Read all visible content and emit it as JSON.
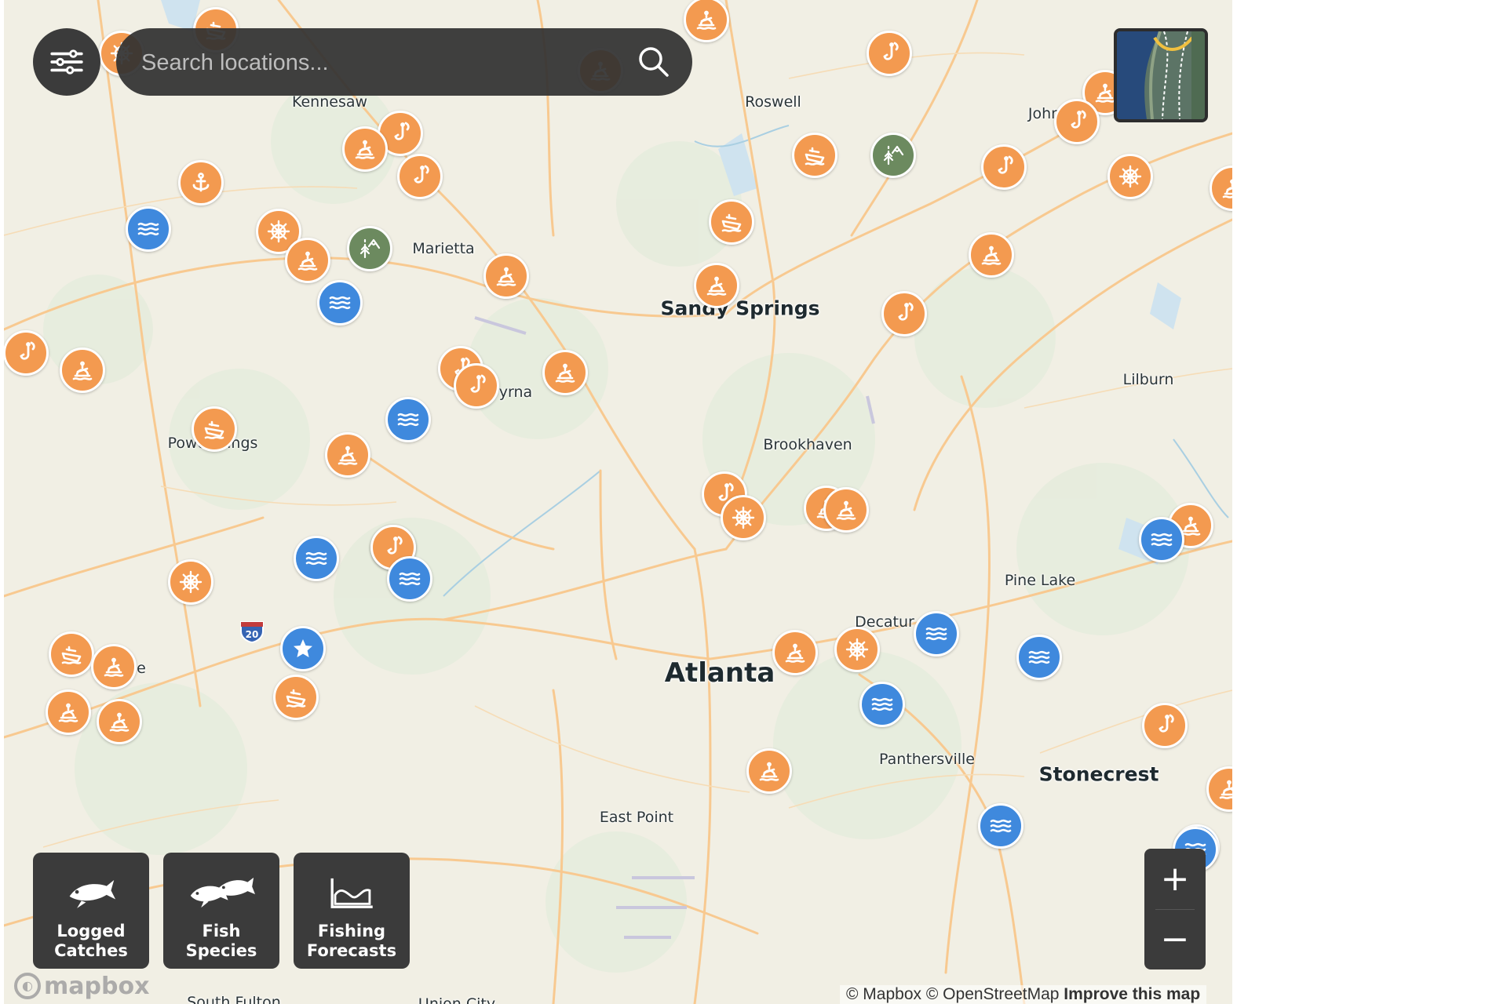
{
  "search": {
    "placeholder": "Search locations..."
  },
  "cities": [
    {
      "name": "Kennesaw",
      "size": "small"
    },
    {
      "name": "Roswell",
      "size": "small"
    },
    {
      "name": "John…",
      "size": "small"
    },
    {
      "name": "Marietta",
      "size": "small"
    },
    {
      "name": "Sandy Springs",
      "size": "med"
    },
    {
      "name": "Lilburn",
      "size": "small"
    },
    {
      "name": "yrna",
      "size": "small"
    },
    {
      "name": "Powde  rings",
      "size": "small"
    },
    {
      "name": "Brookhaven",
      "size": "small"
    },
    {
      "name": "Pine Lake",
      "size": "small"
    },
    {
      "name": "Decatur",
      "size": "small"
    },
    {
      "name": "Atlanta",
      "size": "big"
    },
    {
      "name": "Panthersville",
      "size": "small"
    },
    {
      "name": "Stonecrest",
      "size": "med"
    },
    {
      "name": "East Point",
      "size": "small"
    },
    {
      "name": "South Fulton",
      "size": "small"
    },
    {
      "name": "Union City",
      "size": "small"
    },
    {
      "name": "e",
      "size": "small"
    }
  ],
  "highway_shield": "20",
  "markers": [
    {
      "kind": "buoy",
      "color": "orange"
    },
    {
      "kind": "boat",
      "color": "orange"
    },
    {
      "kind": "helm",
      "color": "orange"
    },
    {
      "kind": "buoy",
      "color": "orange"
    },
    {
      "kind": "hook",
      "color": "orange"
    },
    {
      "kind": "buoy",
      "color": "orange"
    },
    {
      "kind": "hook",
      "color": "orange"
    },
    {
      "kind": "hook",
      "color": "orange"
    },
    {
      "kind": "buoy",
      "color": "orange"
    },
    {
      "kind": "hook",
      "color": "orange"
    },
    {
      "kind": "anchor",
      "color": "orange"
    },
    {
      "kind": "hook",
      "color": "orange"
    },
    {
      "kind": "helm",
      "color": "orange"
    },
    {
      "kind": "water",
      "color": "blue"
    },
    {
      "kind": "helm",
      "color": "orange"
    },
    {
      "kind": "buoy",
      "color": "orange"
    },
    {
      "kind": "trees",
      "color": "green"
    },
    {
      "kind": "buoy",
      "color": "orange"
    },
    {
      "kind": "water",
      "color": "blue"
    },
    {
      "kind": "boat",
      "color": "orange"
    },
    {
      "kind": "trees",
      "color": "green"
    },
    {
      "kind": "hook",
      "color": "orange"
    },
    {
      "kind": "boat",
      "color": "orange"
    },
    {
      "kind": "buoy",
      "color": "orange"
    },
    {
      "kind": "hook",
      "color": "orange"
    },
    {
      "kind": "buoy",
      "color": "orange"
    },
    {
      "kind": "buoy",
      "color": "orange"
    },
    {
      "kind": "hook",
      "color": "orange"
    },
    {
      "kind": "water",
      "color": "blue"
    },
    {
      "kind": "buoy",
      "color": "orange"
    },
    {
      "kind": "buoy",
      "color": "orange"
    },
    {
      "kind": "hook",
      "color": "orange"
    },
    {
      "kind": "hook",
      "color": "orange"
    },
    {
      "kind": "buoy",
      "color": "orange"
    },
    {
      "kind": "water",
      "color": "blue"
    },
    {
      "kind": "boat",
      "color": "orange"
    },
    {
      "kind": "buoy",
      "color": "orange"
    },
    {
      "kind": "hook",
      "color": "orange"
    },
    {
      "kind": "helm",
      "color": "orange"
    },
    {
      "kind": "buoy",
      "color": "orange"
    },
    {
      "kind": "water",
      "color": "blue"
    },
    {
      "kind": "hook",
      "color": "orange"
    },
    {
      "kind": "water",
      "color": "blue"
    },
    {
      "kind": "helm",
      "color": "orange"
    },
    {
      "kind": "star",
      "color": "blue"
    },
    {
      "kind": "boat",
      "color": "orange"
    },
    {
      "kind": "buoy",
      "color": "orange"
    },
    {
      "kind": "buoy",
      "color": "orange"
    },
    {
      "kind": "buoy",
      "color": "orange"
    },
    {
      "kind": "boat",
      "color": "orange"
    },
    {
      "kind": "buoy",
      "color": "orange"
    },
    {
      "kind": "helm",
      "color": "orange"
    },
    {
      "kind": "water",
      "color": "blue"
    },
    {
      "kind": "water",
      "color": "blue"
    },
    {
      "kind": "water",
      "color": "blue"
    },
    {
      "kind": "buoy",
      "color": "orange"
    },
    {
      "kind": "hook",
      "color": "orange"
    },
    {
      "kind": "water",
      "color": "blue"
    },
    {
      "kind": "water",
      "color": "blue"
    },
    {
      "kind": "buoy",
      "color": "orange"
    },
    {
      "kind": "water",
      "color": "blue"
    },
    {
      "kind": "buoy",
      "color": "orange"
    }
  ],
  "bottom_buttons": [
    {
      "label_line1": "Logged",
      "label_line2": "Catches",
      "icon": "fish-icon"
    },
    {
      "label_line1": "Fish",
      "label_line2": "Species",
      "icon": "fish-pair-icon"
    },
    {
      "label_line1": "Fishing",
      "label_line2": "Forecasts",
      "icon": "chart-area-icon"
    }
  ],
  "zoom": {
    "in": "+",
    "out": "−"
  },
  "attribution": {
    "mapbox": "© Mapbox",
    "osm": "© OpenStreetMap",
    "improve": "Improve this map"
  },
  "logo_text": "mapbox",
  "colors": {
    "marker_orange": "#f39a50",
    "marker_blue": "#3f89dd",
    "marker_green": "#6c8a5f",
    "controls": "#3b3b3b",
    "roads": "#f8c990",
    "land": "#f1efe4"
  }
}
